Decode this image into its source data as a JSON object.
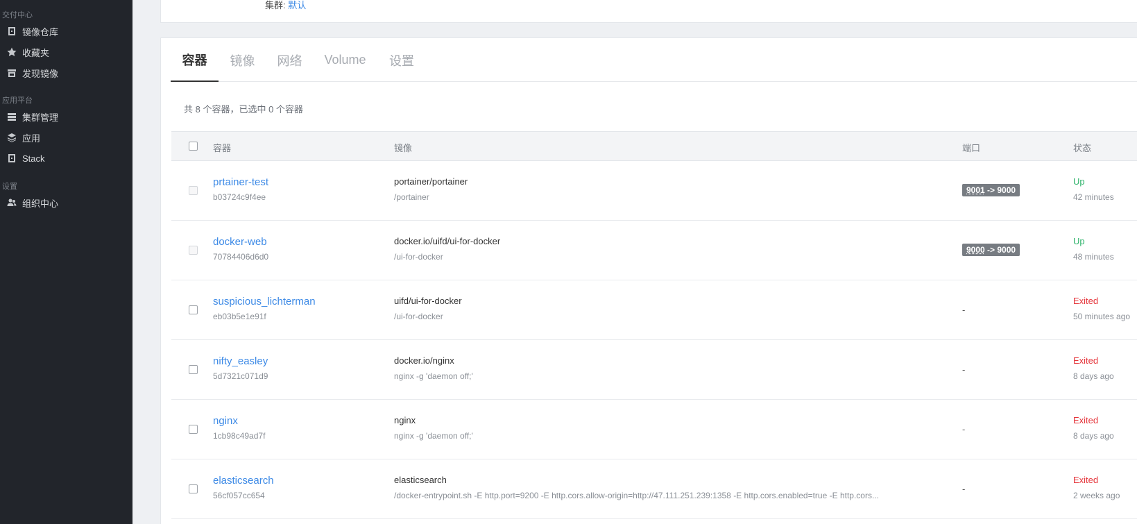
{
  "sidebar": {
    "sections": [
      {
        "title": "交付中心",
        "items": [
          {
            "label": "镜像仓库",
            "icon": "registry-icon"
          },
          {
            "label": "收藏夹",
            "icon": "star-icon"
          },
          {
            "label": "发现镜像",
            "icon": "store-icon"
          }
        ]
      },
      {
        "title": "应用平台",
        "items": [
          {
            "label": "集群管理",
            "icon": "server-icon"
          },
          {
            "label": "应用",
            "icon": "layers-icon"
          },
          {
            "label": "Stack",
            "icon": "stack-icon"
          }
        ]
      },
      {
        "title": "设置",
        "items": [
          {
            "label": "组织中心",
            "icon": "users-icon"
          }
        ]
      }
    ]
  },
  "top": {
    "cluster_label": "集群:",
    "cluster_value": "默认"
  },
  "tabs": [
    "容器",
    "镜像",
    "网络",
    "Volume",
    "设置"
  ],
  "summary": "共 8 个容器，已选中 0 个容器",
  "table": {
    "headers": {
      "name": "容器",
      "image": "镜像",
      "port": "端口",
      "status": "状态"
    },
    "rows": [
      {
        "name": "prtainer-test",
        "id": "b03724c9f4ee",
        "image": "portainer/portainer",
        "cmd": "/portainer",
        "port_host": "9001",
        "port_arrow": " -> 9000",
        "status": "Up",
        "time": "42 minutes"
      },
      {
        "name": "docker-web",
        "id": "70784406d6d0",
        "image": "docker.io/uifd/ui-for-docker",
        "cmd": "/ui-for-docker",
        "port_host": "9000",
        "port_arrow": " -> 9000",
        "status": "Up",
        "time": "48 minutes"
      },
      {
        "name": "suspicious_lichterman",
        "id": "eb03b5e1e91f",
        "image": "uifd/ui-for-docker",
        "cmd": "/ui-for-docker",
        "port": "-",
        "status": "Exited",
        "time": "50 minutes ago"
      },
      {
        "name": "nifty_easley",
        "id": "5d7321c071d9",
        "image": "docker.io/nginx",
        "cmd": "nginx -g 'daemon off;'",
        "port": "-",
        "status": "Exited",
        "time": "8 days ago"
      },
      {
        "name": "nginx",
        "id": "1cb98c49ad7f",
        "image": "nginx",
        "cmd": "nginx -g 'daemon off;'",
        "port": "-",
        "status": "Exited",
        "time": "8 days ago"
      },
      {
        "name": "elasticsearch",
        "id": "56cf057cc654",
        "image": "elasticsearch",
        "cmd": "/docker-entrypoint.sh -E http.port=9200 -E http.cors.allow-origin=http://47.111.251.239:1358 -E http.cors.enabled=true -E http.cors...",
        "port": "-",
        "status": "Exited",
        "time": "2 weeks ago"
      }
    ]
  }
}
